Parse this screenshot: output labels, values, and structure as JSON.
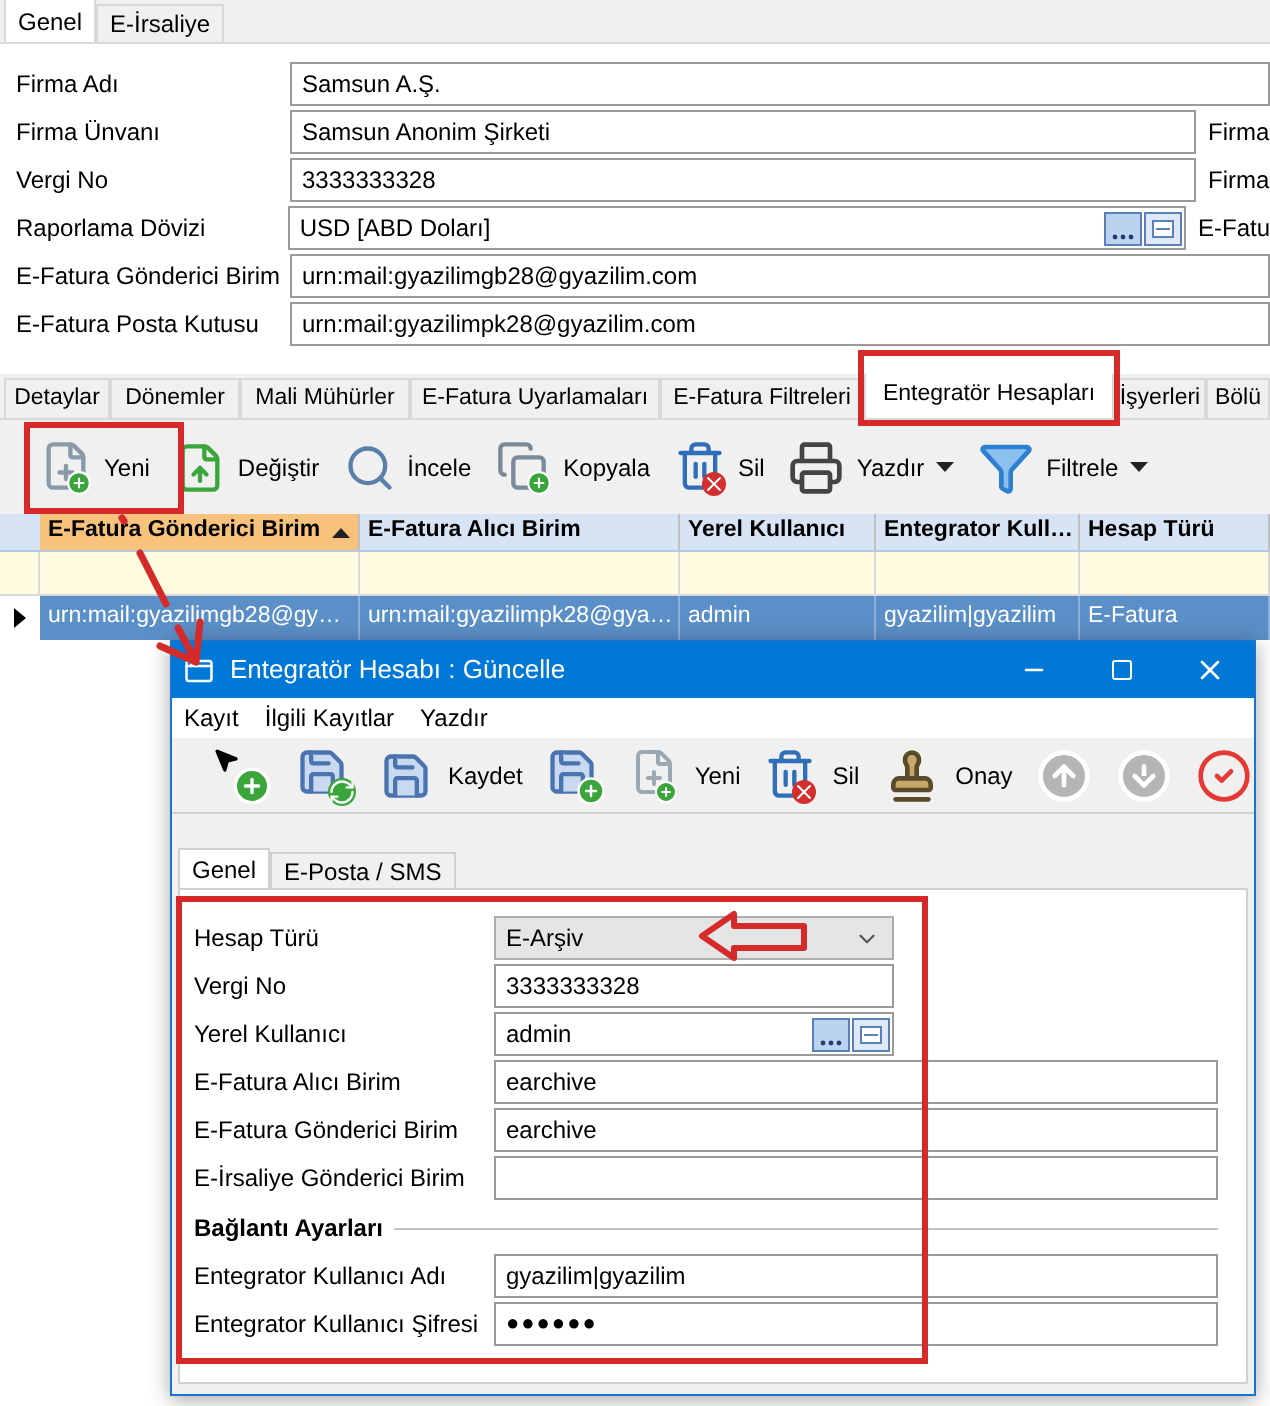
{
  "top_tabs": [
    {
      "label": "Genel",
      "selected": true
    },
    {
      "label": "E-İrsaliye",
      "selected": false
    }
  ],
  "company_form": [
    {
      "label": "Firma Adı",
      "value": "Samsun A.Ş.",
      "kind": "wide"
    },
    {
      "label": "Firma Ünvanı",
      "value": "Samsun Anonim Şirketi",
      "kind": "text",
      "side_label": "Firma"
    },
    {
      "label": "Vergi No",
      "value": "3333333328",
      "kind": "text",
      "side_label": "Firma"
    },
    {
      "label": "Raporlama Dövizi",
      "value": "USD [ABD Doları]",
      "kind": "lookup",
      "side_label": "E-Fatu"
    },
    {
      "label": "E-Fatura Gönderici Birim",
      "value": "urn:mail:gyazilimgb28@gyazilim.com",
      "kind": "wide"
    },
    {
      "label": "E-Fatura Posta Kutusu",
      "value": "urn:mail:gyazilimpk28@gyazilim.com",
      "kind": "wide"
    }
  ],
  "detail_tabs": [
    {
      "label": "Detaylar",
      "selected": false
    },
    {
      "label": "Dönemler",
      "selected": false
    },
    {
      "label": "Mali Mühürler",
      "selected": false
    },
    {
      "label": "E-Fatura Uyarlamaları",
      "selected": false
    },
    {
      "label": "E-Fatura Filtreleri",
      "selected": false
    },
    {
      "label": "Entegratör Hesapları",
      "selected": true
    },
    {
      "label": "İşyerleri",
      "selected": false
    },
    {
      "label": "Bölü",
      "selected": false
    }
  ],
  "toolbar": [
    {
      "label": "Yeni",
      "dropdown": false
    },
    {
      "label": "Değiştir",
      "dropdown": false
    },
    {
      "label": "İncele",
      "dropdown": false
    },
    {
      "label": "Kopyala",
      "dropdown": false
    },
    {
      "label": "Sil",
      "dropdown": false
    },
    {
      "label": "Yazdır",
      "dropdown": true
    },
    {
      "label": "Filtrele",
      "dropdown": true
    }
  ],
  "grid": {
    "columns": [
      {
        "label": "E-Fatura Gönderici Birim",
        "sorted": true
      },
      {
        "label": "E-Fatura Alıcı Birim",
        "sorted": false
      },
      {
        "label": "Yerel Kullanıcı",
        "sorted": false
      },
      {
        "label": "Entegrator Kull…",
        "sorted": false
      },
      {
        "label": "Hesap Türü",
        "sorted": false
      }
    ],
    "rows": [
      {
        "selected": true,
        "cells": [
          "urn:mail:gyazilimgb28@gy…",
          "urn:mail:gyazilimpk28@gya…",
          "admin",
          "gyazilim|gyazilim",
          "E-Fatura"
        ]
      }
    ]
  },
  "dialog": {
    "title": "Entegratör Hesabı : Güncelle",
    "menu": [
      "Kayıt",
      "İlgili Kayıtlar",
      "Yazdır"
    ],
    "toolbar": [
      {
        "kind": "add"
      },
      {
        "kind": "save-refresh"
      },
      {
        "kind": "save",
        "label": "Kaydet"
      },
      {
        "kind": "save-add"
      },
      {
        "kind": "new",
        "label": "Yeni"
      },
      {
        "kind": "delete",
        "label": "Sil"
      },
      {
        "kind": "approve",
        "label": "Onay"
      },
      {
        "kind": "up"
      },
      {
        "kind": "down"
      },
      {
        "kind": "check"
      }
    ],
    "tabs": [
      {
        "label": "Genel",
        "selected": true
      },
      {
        "label": "E-Posta / SMS",
        "selected": false
      }
    ],
    "fields": [
      {
        "label": "Hesap Türü",
        "value": "E-Arşiv",
        "kind": "combo"
      },
      {
        "label": "Vergi No",
        "value": "3333333328",
        "kind": "short"
      },
      {
        "label": "Yerel Kullanıcı",
        "value": "admin",
        "kind": "lookup"
      },
      {
        "label": "E-Fatura Alıcı Birim",
        "value": "earchive",
        "kind": "text"
      },
      {
        "label": "E-Fatura Gönderici Birim",
        "value": "earchive",
        "kind": "text"
      },
      {
        "label": "E-İrsaliye Gönderici Birim",
        "kind": "text"
      }
    ],
    "section": "Bağlantı Ayarları",
    "connection_fields": [
      {
        "label": "Entegrator Kullanıcı Adı",
        "value": "gyazilim|gyazilim",
        "kind": "text"
      },
      {
        "label": "Entegrator Kullanıcı Şifresi",
        "value": "●●●●●●",
        "kind": "password"
      }
    ]
  }
}
